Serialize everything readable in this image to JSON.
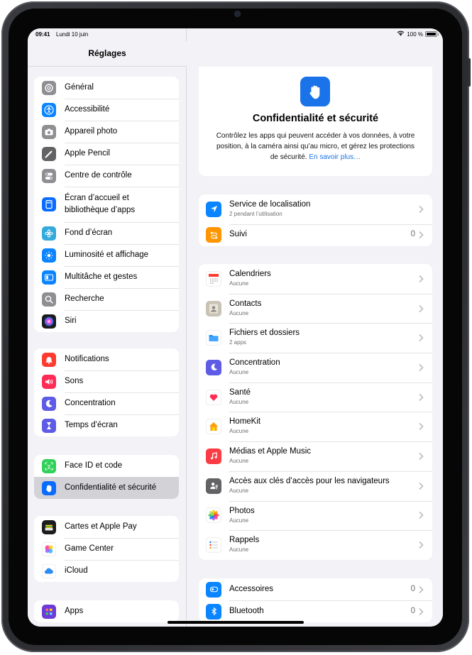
{
  "status": {
    "time": "09:41",
    "date": "Lundi 10 juin",
    "battery": "100 %"
  },
  "sidebar": {
    "title": "Réglages",
    "groups": [
      [
        {
          "label": "Général",
          "icon": "gear-icon",
          "color": "#8e8e93"
        },
        {
          "label": "Accessibilité",
          "icon": "accessibility-icon",
          "color": "#0a84ff"
        },
        {
          "label": "Appareil photo",
          "icon": "camera-icon",
          "color": "#8e8e93"
        },
        {
          "label": "Apple Pencil",
          "icon": "pencil-icon",
          "color": "#636366"
        },
        {
          "label": "Centre de contrôle",
          "icon": "toggles-icon",
          "color": "#8e8e93"
        },
        {
          "label": "Écran d’accueil et bibliothèque d’apps",
          "icon": "home-screen-icon",
          "color": "#0a6cff"
        },
        {
          "label": "Fond d’écran",
          "icon": "wallpaper-icon",
          "color": "#34aadc"
        },
        {
          "label": "Luminosité et affichage",
          "icon": "brightness-icon",
          "color": "#0a84ff"
        },
        {
          "label": "Multitâche et gestes",
          "icon": "multitasking-icon",
          "color": "#0a84ff"
        },
        {
          "label": "Recherche",
          "icon": "search-icon",
          "color": "#8e8e93"
        },
        {
          "label": "Siri",
          "icon": "siri-icon",
          "color": "#1c1c1e"
        }
      ],
      [
        {
          "label": "Notifications",
          "icon": "bell-icon",
          "color": "#ff3b30"
        },
        {
          "label": "Sons",
          "icon": "speaker-icon",
          "color": "#ff2d55"
        },
        {
          "label": "Concentration",
          "icon": "moon-icon",
          "color": "#5e5ce6"
        },
        {
          "label": "Temps d’écran",
          "icon": "hourglass-icon",
          "color": "#5e5ce6"
        }
      ],
      [
        {
          "label": "Face ID et code",
          "icon": "faceid-icon",
          "color": "#30d158"
        },
        {
          "label": "Confidentialité et sécurité",
          "icon": "hand-icon",
          "color": "#0a6cff"
        }
      ],
      [
        {
          "label": "Cartes et Apple Pay",
          "icon": "wallet-icon",
          "color": "#1c1c1e"
        },
        {
          "label": "Game Center",
          "icon": "game-center-icon",
          "color": "#ffffff"
        },
        {
          "label": "iCloud",
          "icon": "cloud-icon",
          "color": "#ffffff"
        }
      ],
      [
        {
          "label": "Apps",
          "icon": "apps-icon",
          "color": "#6e3bd8"
        }
      ]
    ]
  },
  "detail": {
    "hero": {
      "title": "Confidentialité et sécurité",
      "description": "Contrôlez les apps qui peuvent accéder à vos données, à votre position, à la caméra ainsi qu’au micro, et gérez les protections de sécurité.",
      "link": "En savoir plus…"
    },
    "group1": [
      {
        "label": "Service de localisation",
        "sub": "2 pendant l’utilisation",
        "value": "",
        "icon": "location-arrow-icon",
        "color": "#0a84ff"
      },
      {
        "label": "Suivi",
        "sub": "",
        "value": "0",
        "icon": "tracking-icon",
        "color": "#ff9500"
      }
    ],
    "group2": [
      {
        "label": "Calendriers",
        "sub": "Aucune",
        "icon": "calendar-icon",
        "color": "#ffffff"
      },
      {
        "label": "Contacts",
        "sub": "Aucune",
        "icon": "contacts-icon",
        "color": "#c9c3b6"
      },
      {
        "label": "Fichiers et dossiers",
        "sub": "2 apps",
        "icon": "folder-icon",
        "color": "#ffffff"
      },
      {
        "label": "Concentration",
        "sub": "Aucune",
        "icon": "moon-icon",
        "color": "#5e5ce6"
      },
      {
        "label": "Santé",
        "sub": "Aucune",
        "icon": "heart-icon",
        "color": "#ffffff"
      },
      {
        "label": "HomeKit",
        "sub": "Aucune",
        "icon": "house-icon",
        "color": "#ffffff"
      },
      {
        "label": "Médias et Apple Music",
        "sub": "Aucune",
        "icon": "music-note-icon",
        "color": "#fc3c44"
      },
      {
        "label": "Accès aux clés d’accès pour les navigateurs",
        "sub": "Aucune",
        "icon": "person-key-icon",
        "color": "#636366"
      },
      {
        "label": "Photos",
        "sub": "Aucune",
        "icon": "photos-icon",
        "color": "#ffffff"
      },
      {
        "label": "Rappels",
        "sub": "Aucune",
        "icon": "reminders-icon",
        "color": "#ffffff"
      }
    ],
    "group3": [
      {
        "label": "Accessoires",
        "value": "0",
        "icon": "accessories-icon",
        "color": "#0a84ff"
      },
      {
        "label": "Bluetooth",
        "value": "0",
        "icon": "bluetooth-icon",
        "color": "#0a84ff"
      }
    ]
  }
}
